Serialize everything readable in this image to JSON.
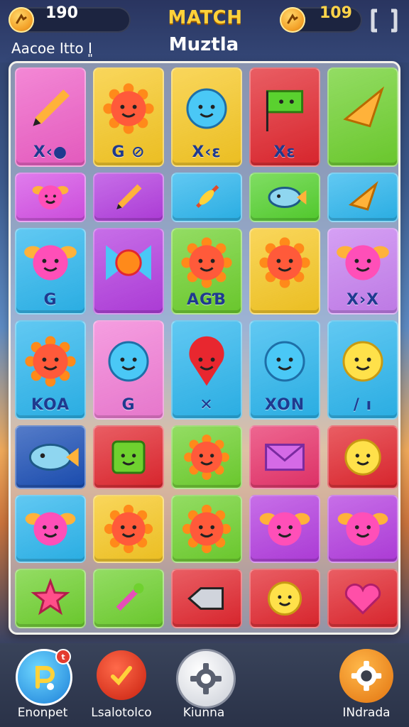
{
  "header": {
    "left_counter": "190",
    "right_counter": "109",
    "title_line1": "MATCH",
    "title_line2": "Muztla",
    "level_text": "Aacoe Itto I͈",
    "coin_icon": "coin-icon",
    "exit_icon": "exit-icon"
  },
  "board": {
    "rows": [
      [
        {
          "color": "#ef5fc7",
          "icon": "pencil-icon",
          "label": "X‹●"
        },
        {
          "color": "#f7c824",
          "icon": "sun-face-icon",
          "label": "G ⊘"
        },
        {
          "color": "#f7c824",
          "icon": "blob-face-icon",
          "label": "X‹ε"
        },
        {
          "color": "#e2272f",
          "icon": "flag-icon",
          "label": "Xε"
        },
        {
          "color": "#6fd12f",
          "icon": "diamond-icon",
          "label": ""
        }
      ],
      [
        {
          "color": "#d550e6",
          "icon": "bug-face-icon",
          "label": ""
        },
        {
          "color": "#b43ee0",
          "icon": "pencil-icon",
          "label": ""
        },
        {
          "color": "#2cb6ee",
          "icon": "sword-icon",
          "label": ""
        },
        {
          "color": "#55d22f",
          "icon": "fish-icon",
          "label": ""
        },
        {
          "color": "#2cb6ee",
          "icon": "diamond-icon",
          "label": ""
        }
      ],
      [
        {
          "color": "#2cb6ee",
          "icon": "bug-face-icon",
          "label": "G"
        },
        {
          "color": "#b43ee0",
          "icon": "candy-icon",
          "label": ""
        },
        {
          "color": "#6fd12f",
          "icon": "sun-face-icon",
          "label": "AGƁ"
        },
        {
          "color": "#f7c824",
          "icon": "sun-face-icon",
          "label": ""
        },
        {
          "color": "#c780f0",
          "icon": "bug-face-icon",
          "label": "X›X"
        }
      ],
      [
        {
          "color": "#2cb6ee",
          "icon": "sun-face-icon",
          "label": "KOA"
        },
        {
          "color": "#f27dd6",
          "icon": "blob-face-icon",
          "label": "G"
        },
        {
          "color": "#2cb6ee",
          "icon": "balloon-face-icon",
          "label": "✕"
        },
        {
          "color": "#2cb6ee",
          "icon": "blob-face-icon",
          "label": "XON"
        },
        {
          "color": "#2cb6ee",
          "icon": "smiley-icon",
          "label": "/ ı"
        }
      ],
      [
        {
          "color": "#1b4fb6",
          "icon": "fish-icon",
          "label": ""
        },
        {
          "color": "#e2272f",
          "icon": "square-face-icon",
          "label": ""
        },
        {
          "color": "#6fd12f",
          "icon": "sun-face-icon",
          "label": ""
        },
        {
          "color": "#e8336b",
          "icon": "envelope-icon",
          "label": ""
        },
        {
          "color": "#e2272f",
          "icon": "smiley-icon",
          "label": ""
        }
      ],
      [
        {
          "color": "#2cb6ee",
          "icon": "bug-face-icon",
          "label": ""
        },
        {
          "color": "#f7c824",
          "icon": "sun-face-icon",
          "label": ""
        },
        {
          "color": "#6fd12f",
          "icon": "sun-face-icon",
          "label": ""
        },
        {
          "color": "#b43ee0",
          "icon": "bug-face-icon",
          "label": ""
        },
        {
          "color": "#b43ee0",
          "icon": "bug-face-icon",
          "label": ""
        }
      ],
      [
        {
          "color": "#6fd12f",
          "icon": "star-icon",
          "label": ""
        },
        {
          "color": "#6fd12f",
          "icon": "brush-icon",
          "label": ""
        },
        {
          "color": "#e2272f",
          "icon": "chip-icon",
          "label": ""
        },
        {
          "color": "#e2272f",
          "icon": "smiley-icon",
          "label": ""
        },
        {
          "color": "#e2272f",
          "icon": "heart-icon",
          "label": ""
        }
      ]
    ]
  },
  "bottom_nav": {
    "items": [
      {
        "label": "Enonpet",
        "icon": "p-character-icon",
        "badge": "t"
      },
      {
        "label": "Lsalotolco",
        "icon": "check-bubble-icon"
      },
      {
        "label": "Kiunna",
        "icon": "gear-icon"
      },
      {
        "label": "INdrada",
        "icon": "gear-icon"
      }
    ]
  }
}
